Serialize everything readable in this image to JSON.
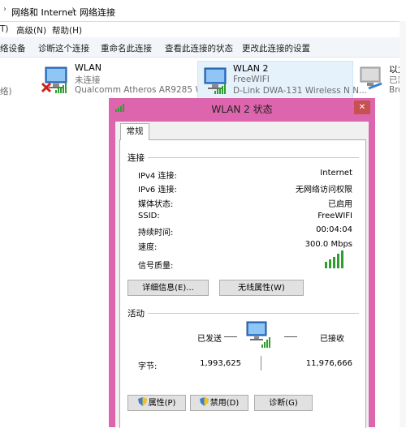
{
  "address": {
    "crumbs": [
      "网络和 Internet",
      "网络连接"
    ],
    "separator": "›"
  },
  "menu": {
    "items": [
      "T)",
      "高级(N)",
      "帮助(H)"
    ]
  },
  "toolbar": {
    "items": [
      "络设备",
      "诊断这个连接",
      "重命名此连接",
      "查看此连接的状态",
      "更改此连接的设置"
    ]
  },
  "adapters": [
    {
      "name": "",
      "status": "",
      "device": "络)"
    },
    {
      "name": "WLAN",
      "status": "未连接",
      "device": "Qualcomm Atheros AR9285 W..."
    },
    {
      "name": "WLAN 2",
      "status": "FreeWIFI",
      "device": "D-Link DWA-131 Wireless N N..."
    },
    {
      "name": "以太网",
      "status": "已禁用",
      "device": "Broa"
    }
  ],
  "dialog": {
    "title": "WLAN 2 状态",
    "close": "✕",
    "tab": "常规",
    "connection": {
      "heading": "连接",
      "rows": [
        {
          "label": "IPv4 连接:",
          "value": "Internet"
        },
        {
          "label": "IPv6 连接:",
          "value": "无网络访问权限"
        },
        {
          "label": "媒体状态:",
          "value": "已启用"
        },
        {
          "label": "SSID:",
          "value": "FreeWIFI"
        },
        {
          "label": "持续时间:",
          "value": "00:04:04"
        },
        {
          "label": "速度:",
          "value": "300.0 Mbps"
        },
        {
          "label": "信号质量:",
          "value": ""
        }
      ],
      "signal_bars": 5,
      "details_button": "详细信息(E)...",
      "wireless_button": "无线属性(W)"
    },
    "activity": {
      "heading": "活动",
      "sent_label": "已发送",
      "received_label": "已接收",
      "bytes_label": "字节:",
      "bytes_sent": "1,993,625",
      "bytes_received": "11,976,666"
    },
    "buttons": {
      "properties": "属性(P)",
      "disable": "禁用(D)",
      "diagnose": "诊断(G)"
    }
  },
  "colors": {
    "title_bar": "#dc65ad",
    "selection": "#e5f1fb",
    "signal": "#2f9e2f",
    "close": "#c75050"
  }
}
